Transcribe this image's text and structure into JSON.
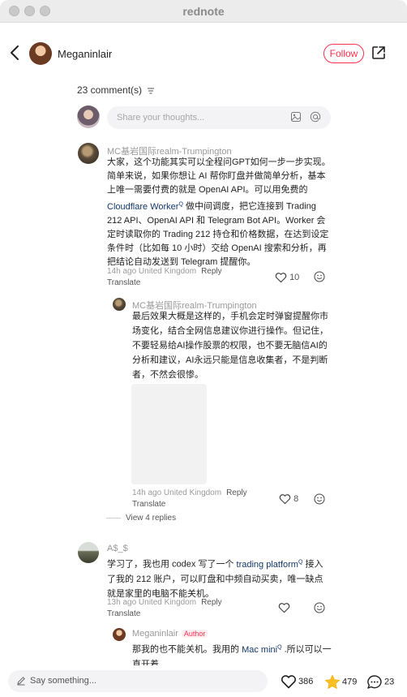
{
  "window": {
    "title": "rednote"
  },
  "post": {
    "username": "Meganinlair",
    "follow_label": "Follow"
  },
  "comments_count": "23 comment(s)",
  "composer": {
    "placeholder": "Share your thoughts..."
  },
  "comments": [
    {
      "author": "MC基岩国际realm-Trumpington",
      "text_a": "大家，这个功能其实可以全程问GPT如何一步一步实现。简单来说，如果你想让 AI 帮你盯盘并做简单分析，基本上唯一需要付费的就是 OpenAI API。可以用免费的",
      "link": "Cloudflare Worker",
      "text_b": " 做中间调度，把它连接到 Trading 212 API、OpenAI API 和 Telegram Bot API。Worker 会定时读取你的 Trading 212 持仓和价格数据，在达到设定条件时（比如每 10 小时）交给 OpenAI 搜索和分析，再把结论自动发送到 Telegram 提醒你。",
      "time": "14h ago United Kingdom",
      "reply": "Reply",
      "translate": "Translate",
      "likes": "10"
    },
    {
      "author": "MC基岩国际realm-Trumpington",
      "text": "最后效果大概是这样的，手机会定时弹窗提醒你市场变化，结合全网信息建议你进行操作。但记住，不要轻易给AI操作股票的权限，也不要无脑信AI的分析和建议，AI永远只能是信息收集者，不是判断者，不然会很惨。",
      "time": "14h ago United Kingdom",
      "reply": "Reply",
      "translate": "Translate",
      "likes": "8"
    },
    {
      "view_replies": "View 4 replies"
    },
    {
      "author": "A$_$",
      "text_a": "学习了，我也用 codex 写了一个 ",
      "link": "trading platform",
      "text_b": " 接入了我的 212 账户，可以盯盘和中频自动买卖，唯一缺点就是家里的电脑不能关机。",
      "time": "13h ago United Kingdom",
      "reply": "Reply",
      "translate": "Translate"
    },
    {
      "author": "Meganinlair",
      "badge": "Author",
      "text_a": "那我的也不能关机。我用的 ",
      "link": "Mac mini",
      "text_b": " .所以可以一直开着"
    }
  ],
  "bottom": {
    "say_placeholder": "Say something...",
    "likes": "386",
    "stars": "479",
    "comments": "23"
  },
  "colors": {
    "accent": "#ff2e4d",
    "link": "#13386c",
    "star": "#fbbf24"
  }
}
